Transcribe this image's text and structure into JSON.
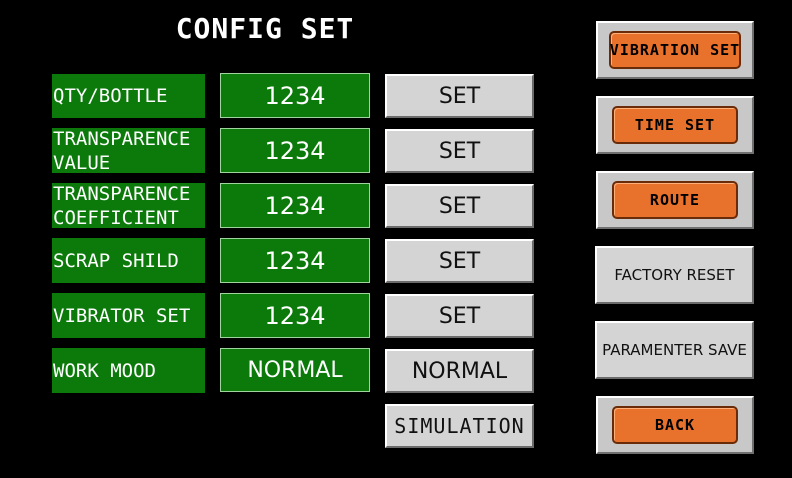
{
  "title": "CONFIG SET",
  "rows": [
    {
      "label": "QTY/BOTTLE",
      "value": "1234",
      "button": "SET"
    },
    {
      "label": "TRANSPARENCE\nVALUE",
      "value": "1234",
      "button": "SET"
    },
    {
      "label": "TRANSPARENCE\nCOEFFICIENT",
      "value": "1234",
      "button": "SET"
    },
    {
      "label": "SCRAP SHILD",
      "value": "1234",
      "button": "SET"
    },
    {
      "label": "VIBRATOR SET",
      "value": "1234",
      "button": "SET"
    },
    {
      "label": "WORK MOOD",
      "value": "NORMAL",
      "button": "NORMAL"
    }
  ],
  "simulation_button": "SIMULATION",
  "nav": {
    "vibration_set": "VIBRATION SET",
    "time_set": "TIME SET",
    "route": "ROUTE",
    "factory_reset": "FACTORY RESET",
    "parameter_save": "PARAMENTER SAVE",
    "back": "BACK"
  },
  "colors": {
    "background": "#000000",
    "field_green": "#0b7a0b",
    "button_gray": "#d4d4d4",
    "nav_orange": "#e8712c"
  }
}
